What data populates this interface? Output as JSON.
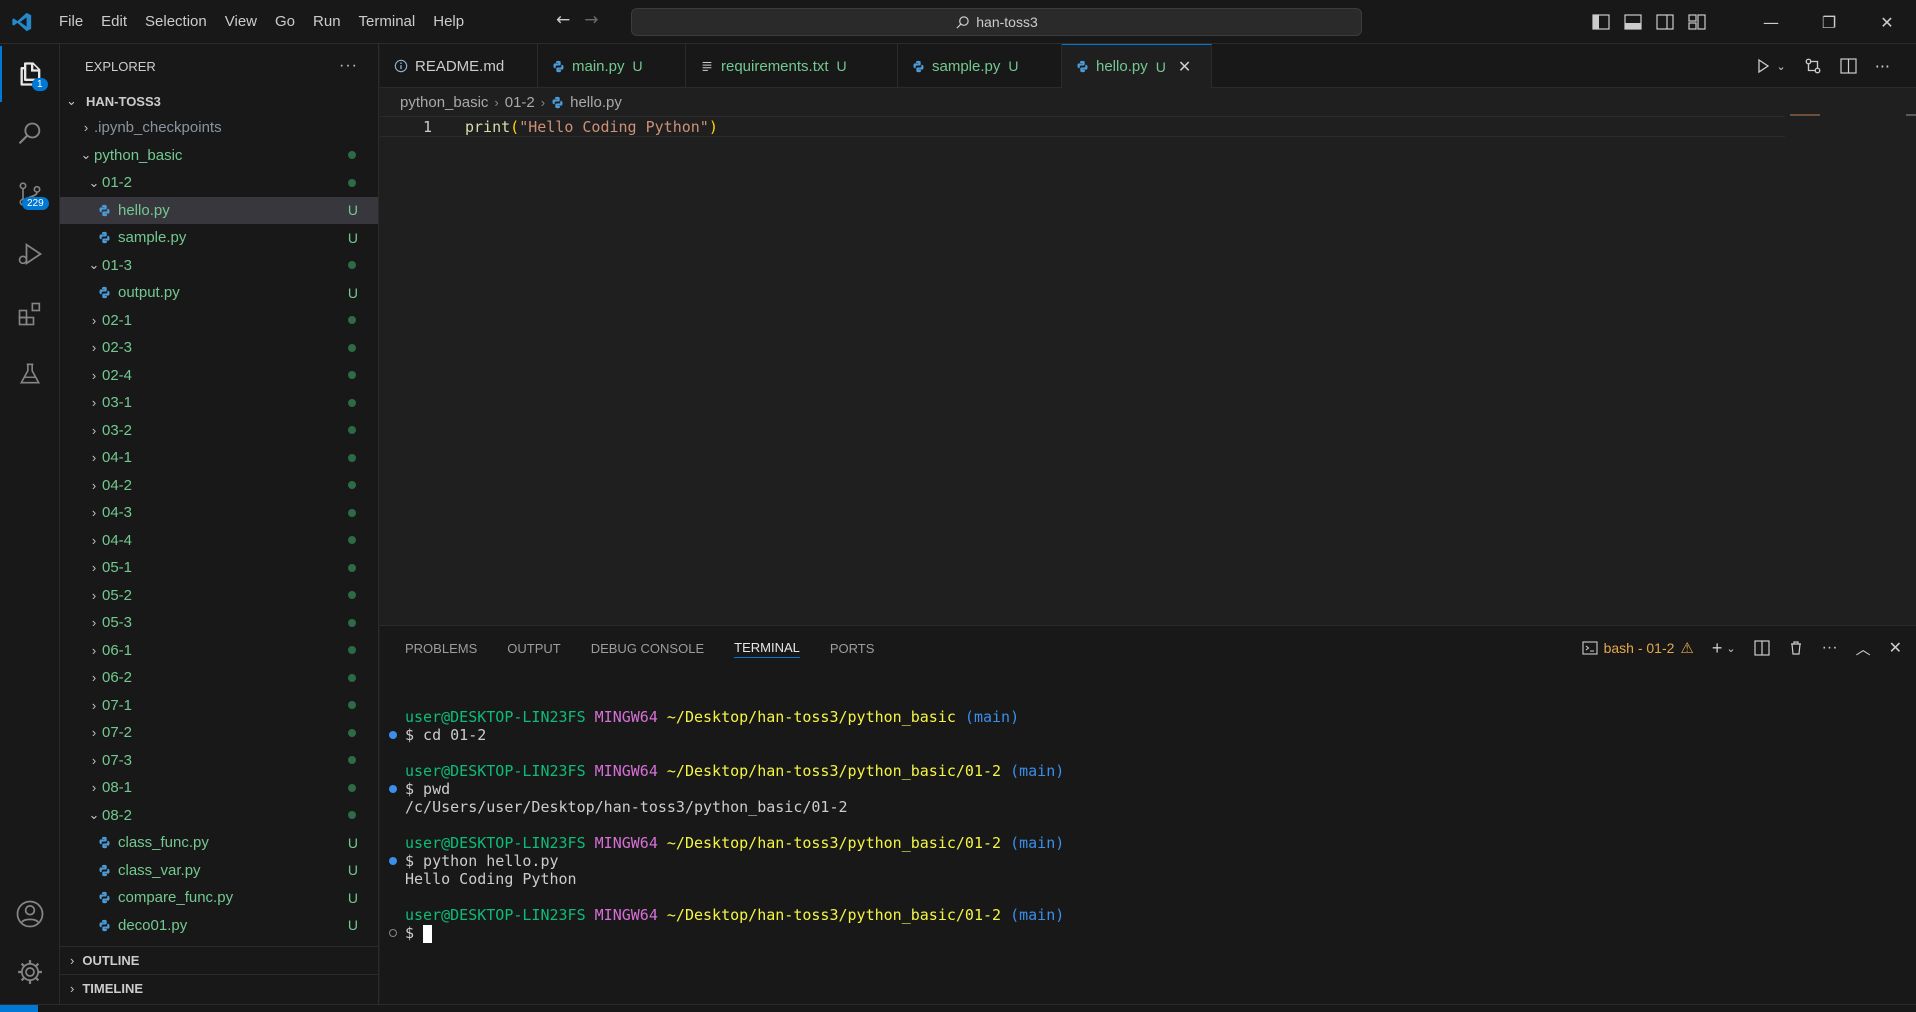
{
  "titlebar": {
    "menu": [
      "File",
      "Edit",
      "Selection",
      "View",
      "Go",
      "Run",
      "Terminal",
      "Help"
    ],
    "search_text": "han-toss3"
  },
  "activity": {
    "explorer_badge": "1",
    "scm_badge": "229"
  },
  "sidebar": {
    "header": "EXPLORER",
    "root": "HAN-TOSS3",
    "tree": [
      {
        "label": ".ipynb_checkpoints",
        "indent": 1,
        "chev": "›",
        "status": "",
        "dot": false,
        "file": false,
        "plain": true
      },
      {
        "label": "python_basic",
        "indent": 1,
        "chev": "⌄",
        "status": "",
        "dot": true,
        "file": false
      },
      {
        "label": "01-2",
        "indent": 2,
        "chev": "⌄",
        "status": "",
        "dot": true,
        "file": false
      },
      {
        "label": "hello.py",
        "indent": 3,
        "chev": "",
        "status": "U",
        "dot": false,
        "file": true,
        "selected": true
      },
      {
        "label": "sample.py",
        "indent": 3,
        "chev": "",
        "status": "U",
        "dot": false,
        "file": true
      },
      {
        "label": "01-3",
        "indent": 2,
        "chev": "⌄",
        "status": "",
        "dot": true,
        "file": false
      },
      {
        "label": "output.py",
        "indent": 3,
        "chev": "",
        "status": "U",
        "dot": false,
        "file": true
      },
      {
        "label": "02-1",
        "indent": 2,
        "chev": "›",
        "status": "",
        "dot": true,
        "file": false
      },
      {
        "label": "02-3",
        "indent": 2,
        "chev": "›",
        "status": "",
        "dot": true,
        "file": false
      },
      {
        "label": "02-4",
        "indent": 2,
        "chev": "›",
        "status": "",
        "dot": true,
        "file": false
      },
      {
        "label": "03-1",
        "indent": 2,
        "chev": "›",
        "status": "",
        "dot": true,
        "file": false
      },
      {
        "label": "03-2",
        "indent": 2,
        "chev": "›",
        "status": "",
        "dot": true,
        "file": false
      },
      {
        "label": "04-1",
        "indent": 2,
        "chev": "›",
        "status": "",
        "dot": true,
        "file": false
      },
      {
        "label": "04-2",
        "indent": 2,
        "chev": "›",
        "status": "",
        "dot": true,
        "file": false
      },
      {
        "label": "04-3",
        "indent": 2,
        "chev": "›",
        "status": "",
        "dot": true,
        "file": false
      },
      {
        "label": "04-4",
        "indent": 2,
        "chev": "›",
        "status": "",
        "dot": true,
        "file": false
      },
      {
        "label": "05-1",
        "indent": 2,
        "chev": "›",
        "status": "",
        "dot": true,
        "file": false
      },
      {
        "label": "05-2",
        "indent": 2,
        "chev": "›",
        "status": "",
        "dot": true,
        "file": false
      },
      {
        "label": "05-3",
        "indent": 2,
        "chev": "›",
        "status": "",
        "dot": true,
        "file": false
      },
      {
        "label": "06-1",
        "indent": 2,
        "chev": "›",
        "status": "",
        "dot": true,
        "file": false
      },
      {
        "label": "06-2",
        "indent": 2,
        "chev": "›",
        "status": "",
        "dot": true,
        "file": false
      },
      {
        "label": "07-1",
        "indent": 2,
        "chev": "›",
        "status": "",
        "dot": true,
        "file": false
      },
      {
        "label": "07-2",
        "indent": 2,
        "chev": "›",
        "status": "",
        "dot": true,
        "file": false
      },
      {
        "label": "07-3",
        "indent": 2,
        "chev": "›",
        "status": "",
        "dot": true,
        "file": false
      },
      {
        "label": "08-1",
        "indent": 2,
        "chev": "›",
        "status": "",
        "dot": true,
        "file": false
      },
      {
        "label": "08-2",
        "indent": 2,
        "chev": "⌄",
        "status": "",
        "dot": true,
        "file": false
      },
      {
        "label": "class_func.py",
        "indent": 3,
        "chev": "",
        "status": "U",
        "dot": false,
        "file": true
      },
      {
        "label": "class_var.py",
        "indent": 3,
        "chev": "",
        "status": "U",
        "dot": false,
        "file": true
      },
      {
        "label": "compare_func.py",
        "indent": 3,
        "chev": "",
        "status": "U",
        "dot": false,
        "file": true
      },
      {
        "label": "deco01.py",
        "indent": 3,
        "chev": "",
        "status": "U",
        "dot": false,
        "file": true
      }
    ],
    "outline": "OUTLINE",
    "timeline": "TIMELINE"
  },
  "tabs": [
    {
      "label": "README.md",
      "icon": "info",
      "status": "",
      "modified": true,
      "active": false
    },
    {
      "label": "main.py",
      "icon": "python",
      "status": "U",
      "modified": false,
      "active": false
    },
    {
      "label": "requirements.txt",
      "icon": "text",
      "status": "U",
      "modified": false,
      "active": false
    },
    {
      "label": "sample.py",
      "icon": "python",
      "status": "U",
      "modified": false,
      "active": false
    },
    {
      "label": "hello.py",
      "icon": "python",
      "status": "U",
      "modified": false,
      "active": true
    }
  ],
  "breadcrumb": [
    "python_basic",
    "01-2",
    "hello.py"
  ],
  "editor": {
    "line_number": "1",
    "code_fn": "print",
    "code_open": "(",
    "code_str": "\"Hello Coding Python\"",
    "code_close": ")"
  },
  "panel": {
    "tabs": [
      "PROBLEMS",
      "OUTPUT",
      "DEBUG CONSOLE",
      "TERMINAL",
      "PORTS"
    ],
    "active_tab": "TERMINAL",
    "terminal_name": "bash - 01-2"
  },
  "terminal": {
    "user": "user@DESKTOP-LIN23FS",
    "env": "MINGW64",
    "branch": "(main)",
    "blocks": [
      {
        "path": "~/Desktop/han-toss3/python_basic",
        "cmd": "$ cd 01-2",
        "output": ""
      },
      {
        "path": "~/Desktop/han-toss3/python_basic/01-2",
        "cmd": "$ pwd",
        "output": "/c/Users/user/Desktop/han-toss3/python_basic/01-2"
      },
      {
        "path": "~/Desktop/han-toss3/python_basic/01-2",
        "cmd": "$ python hello.py",
        "output": "Hello Coding Python"
      },
      {
        "path": "~/Desktop/han-toss3/python_basic/01-2",
        "cmd": "$ ",
        "output": ""
      }
    ]
  },
  "colors": {
    "accent": "#0078d4",
    "untracked": "#73c991"
  }
}
